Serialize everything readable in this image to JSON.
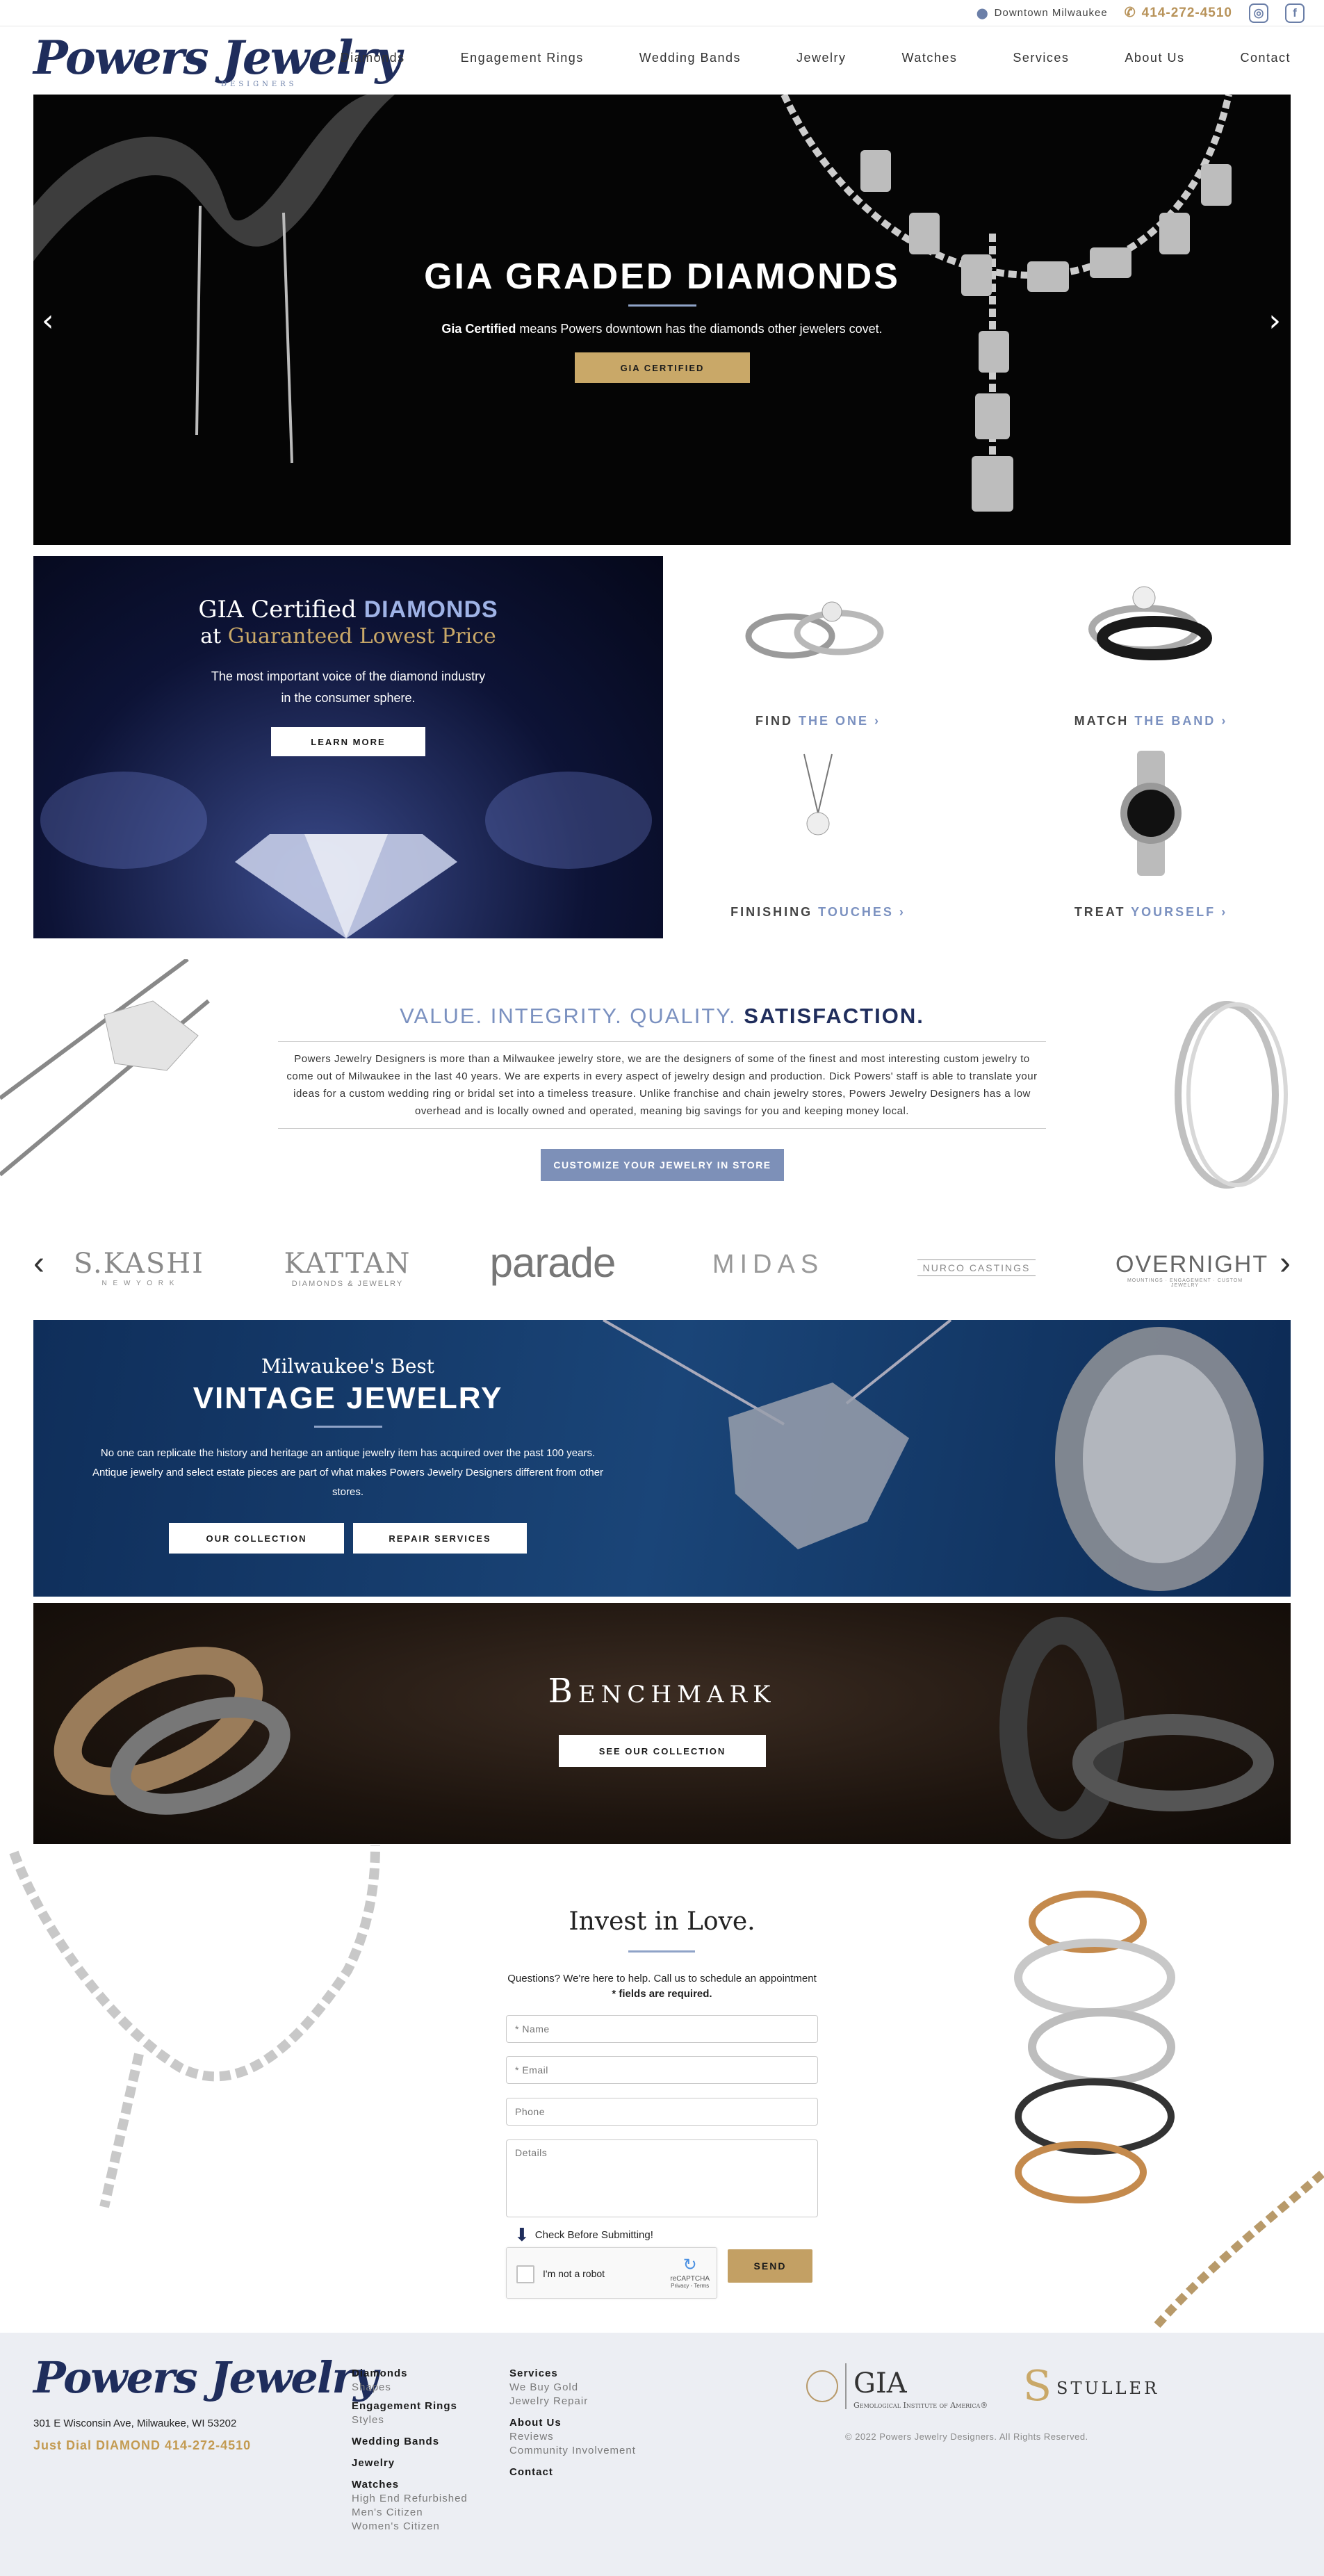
{
  "topbar": {
    "location": "Downtown Milwaukee",
    "phone": "414-272-4510",
    "instagram_icon": "instagram-icon",
    "facebook_icon": "facebook-icon"
  },
  "header": {
    "logo": "Powers Jewelry",
    "logo_sub": "DESIGNERS"
  },
  "nav": [
    "Diamonds",
    "Engagement Rings",
    "Wedding Bands",
    "Jewelry",
    "Watches",
    "Services",
    "About Us",
    "Contact"
  ],
  "hero": {
    "title": "GIA GRADED DIAMONDS",
    "sub_bold": "Gia Certified",
    "sub_rest": " means Powers downtown has the diamonds other jewelers covet.",
    "button": "GIA CERTIFIED",
    "prev": "‹",
    "next": "›"
  },
  "gia_card": {
    "line1_a": "GIA Certified ",
    "line1_b": "DIAMONDS",
    "line2_a": "at ",
    "line2_b": "Guaranteed Lowest Price",
    "body": "The most important voice of the diamond industry in the consumer sphere.",
    "button": "LEARN MORE"
  },
  "tiles": [
    {
      "a": "FIND ",
      "b": "THE ONE",
      "arrow": "›"
    },
    {
      "a": "MATCH ",
      "b": "THE BAND",
      "arrow": "›"
    },
    {
      "a": "FINISHING ",
      "b": "TOUCHES",
      "arrow": "›"
    },
    {
      "a": "TREAT ",
      "b": "YOURSELF",
      "arrow": "›"
    }
  ],
  "value": {
    "title_a": "VALUE. INTEGRITY. QUALITY. ",
    "title_b": "SATISFACTION.",
    "body": "Powers Jewelry Designers is more than a Milwaukee jewelry store, we are the designers of some of the finest and most interesting custom jewelry to come out of Milwaukee in the last 40 years. We are experts in every aspect of jewelry design and production. Dick Powers' staff is able to translate your ideas for a custom wedding ring or bridal set into a timeless treasure. Unlike franchise and chain jewelry stores, Powers Jewelry Designers has a low overhead and is locally owned and operated, meaning big savings for you and keeping money local.",
    "button": "CUSTOMIZE YOUR JEWELRY IN STORE"
  },
  "brands": {
    "prev": "‹",
    "next": "›",
    "items": [
      {
        "name": "S.KASHI",
        "sub": "N E W Y O R K"
      },
      {
        "name": "KATTAN",
        "sub": "DIAMONDS & JEWELRY"
      },
      {
        "name": "parade",
        "sub": ""
      },
      {
        "name": "MIDAS",
        "sub": ""
      },
      {
        "name": "NURCO CASTINGS",
        "sub": ""
      },
      {
        "name": "OVERNIGHT",
        "sub": "MOUNTINGS · ENGAGEMENT · CUSTOM JEWELRY"
      }
    ]
  },
  "vintage": {
    "kicker": "Milwaukee's Best",
    "title": "VINTAGE JEWELRY",
    "body": "No one can replicate the history and heritage an antique jewelry item has acquired over the past 100 years. Antique jewelry and select estate pieces are part of what makes Powers Jewelry Designers different from other stores.",
    "btn1": "OUR COLLECTION",
    "btn2": "REPAIR SERVICES"
  },
  "benchmark": {
    "title": "Benchmark",
    "button": "SEE OUR COLLECTION"
  },
  "form": {
    "title": "Invest in Love.",
    "help1": "Questions? We're here to help. Call us to schedule an appointment",
    "help2": "* fields are required.",
    "name_ph": "* Name",
    "email_ph": "* Email",
    "phone_ph": "Phone",
    "details_ph": "Details",
    "check_hint": "Check Before Submitting!",
    "captcha_label": "I'm not a robot",
    "captcha_brand": "reCAPTCHA",
    "captcha_links": "Privacy - Terms",
    "send": "SEND"
  },
  "footer": {
    "logo": "Powers Jewelry",
    "address": "301 E Wisconsin Ave, Milwaukee, WI 53202",
    "dial": "Just Dial DIAMOND 414-272-4510",
    "col1": [
      {
        "h": "Diamonds",
        "s": [
          "Shapes"
        ]
      },
      {
        "h": "Engagement Rings",
        "s": [
          "Styles"
        ]
      },
      {
        "h": "Wedding Bands",
        "s": []
      },
      {
        "h": "Jewelry",
        "s": []
      },
      {
        "h": "Watches",
        "s": [
          "High End Refurbished",
          "Men's Citizen",
          "Women's Citizen"
        ]
      }
    ],
    "col2": [
      {
        "h": "Services",
        "s": [
          "We Buy Gold",
          "Jewelry Repair"
        ]
      },
      {
        "h": "About Us",
        "s": [
          "Reviews",
          "Community Involvement"
        ]
      },
      {
        "h": "Contact",
        "s": []
      }
    ],
    "gia": "GIA",
    "gia_sub": "Gemological Institute of America®",
    "stuller": "STULLER",
    "copyright": "© 2022 Powers Jewelry Designers. All Rights Reserved."
  }
}
